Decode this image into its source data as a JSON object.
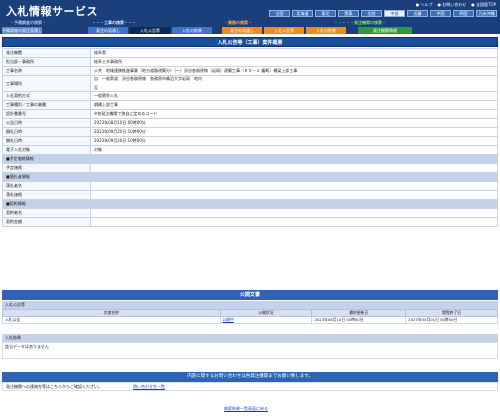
{
  "header": {
    "title": "入札情報サービス",
    "top_links": [
      "● ヘルプ",
      "● お問い合わせ",
      "● 全国版TOP"
    ],
    "regions": [
      "全国",
      "北海道",
      "東北",
      "関東",
      "北陸",
      "中部",
      "近畿",
      "中国",
      "四国",
      "九州沖縄"
    ]
  },
  "categories": [
    {
      "label": "・予備調査の検索・",
      "color": "#9fc0f0"
    },
    {
      "label": "・・・工事の検索・・・",
      "color": "#d8e6ff"
    },
    {
      "label": "・業務の検索・",
      "color": "#f5a24a"
    },
    {
      "label": "・・・・・発注機関の検索・",
      "color": "#7ed36a"
    }
  ],
  "tabs": [
    {
      "label": "予備調査の発注見通し",
      "style": "blue1"
    },
    {
      "label": "発注の見通し",
      "style": "blue2"
    },
    {
      "label": "入札公告等",
      "style": "dark"
    },
    {
      "label": "入札の結果",
      "style": "blue2"
    },
    {
      "label": "発注の見通し",
      "style": "orange"
    },
    {
      "label": "入札公告等",
      "style": "orange"
    },
    {
      "label": "入札の結果",
      "style": "orange"
    },
    {
      "label": "発注機関情報",
      "style": "green"
    }
  ],
  "main": {
    "banner": "入札公告等（工事）案件概要",
    "rows": [
      {
        "label": "発注機関",
        "value": "岐阜県",
        "kind": "row"
      },
      {
        "label": "担当部・事務所",
        "value": "岐阜土木事務所",
        "kind": "row"
      },
      {
        "label": "工事名称",
        "value": "公共　地域連携推進事業（地方道路改築分）（一）渋谷各務原線（岩岡）改築工事（Ｒ５－２ 複断）橋梁上部工事",
        "kind": "row"
      },
      {
        "label": "工事場所",
        "value": "自　一般県道　渋谷各務原線　各務原市鵜沼大字岩岡　地内",
        "value2": "至",
        "kind": "tall"
      },
      {
        "label": "入札契約方式",
        "value": "一般競争入札",
        "kind": "row"
      },
      {
        "label": "工事種別／工事の業種",
        "value": "鋼橋上部工事",
        "kind": "row"
      },
      {
        "label": "設計書番号",
        "value": "※各発注機関で独自に定めるコード",
        "kind": "row"
      },
      {
        "label": "公告日時",
        "value": "2023年08月10日 00時00分",
        "kind": "row"
      },
      {
        "label": "開札日時",
        "value": "2023年09月20日 10時00分",
        "kind": "row"
      },
      {
        "label": "開札日時",
        "value": "2023年09月20日 10時00分",
        "kind": "row"
      },
      {
        "label": "電子入札対象",
        "value": "対象",
        "kind": "row"
      },
      {
        "label": "■予定価格情報",
        "value": "",
        "kind": "section"
      },
      {
        "label": "予定価格",
        "value": "",
        "kind": "row"
      },
      {
        "label": "■落札者情報",
        "value": "",
        "kind": "section"
      },
      {
        "label": "落札者名",
        "value": "",
        "kind": "row"
      },
      {
        "label": "落札価格",
        "value": "",
        "kind": "row"
      },
      {
        "label": "■契約情報",
        "value": "",
        "kind": "section"
      },
      {
        "label": "契約者名",
        "value": "",
        "kind": "row"
      },
      {
        "label": "契約金額",
        "value": "",
        "kind": "row"
      }
    ]
  },
  "public_docs": {
    "title": "公開文書",
    "section_label": "入札公告等",
    "columns": [
      "文書名称",
      "公開状況",
      "最終更新日",
      "閲覧終了日"
    ],
    "rows": [
      [
        "入札公告",
        "公開中",
        "2023年08月10日 00時00分",
        "2027年04月01日 00時00分"
      ]
    ]
  },
  "bid_result": {
    "label": "入札結果",
    "empty_text": "該当データはありません"
  },
  "contact": {
    "bar_text": "内容に関するお問い合わせは各発注機関までお願い致します。",
    "row_text": "発注機関への連絡先等はこちらからご確認ください。",
    "link_text": "問い合わせ先一覧"
  },
  "back_link": "検索結果一覧画面に戻る"
}
